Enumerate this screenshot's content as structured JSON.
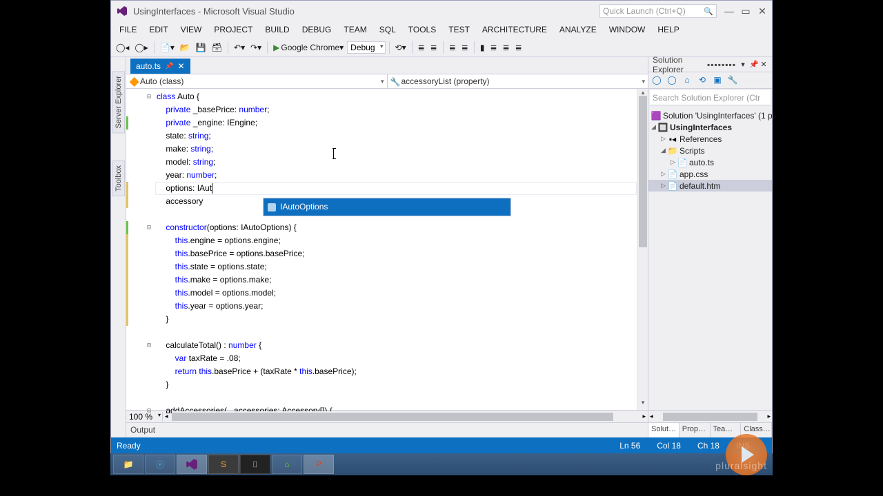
{
  "window": {
    "title": "UsingInterfaces - Microsoft Visual Studio",
    "quickLaunchPlaceholder": "Quick Launch (Ctrl+Q)"
  },
  "menu": [
    "FILE",
    "EDIT",
    "VIEW",
    "PROJECT",
    "BUILD",
    "DEBUG",
    "TEAM",
    "SQL",
    "TOOLS",
    "TEST",
    "ARCHITECTURE",
    "ANALYZE",
    "WINDOW",
    "HELP"
  ],
  "toolbar": {
    "browser": "Google Chrome",
    "config": "Debug"
  },
  "sideTabs": [
    "Server Explorer",
    "Toolbox"
  ],
  "fileTab": {
    "name": "auto.ts"
  },
  "navBar": {
    "left": "Auto (class)",
    "right": "accessoryList (property)"
  },
  "code": {
    "lines": [
      {
        "ind": 0,
        "fold": "⊟",
        "chg": "",
        "seg": [
          {
            "t": "class ",
            "c": "kw"
          },
          {
            "t": "Auto {",
            "c": "id"
          }
        ]
      },
      {
        "ind": 1,
        "chg": "",
        "seg": [
          {
            "t": "private ",
            "c": "kw"
          },
          {
            "t": "_basePrice: ",
            "c": "id"
          },
          {
            "t": "number",
            "c": "ty"
          },
          {
            "t": ";",
            "c": "id"
          }
        ]
      },
      {
        "ind": 1,
        "chg": "green",
        "seg": [
          {
            "t": "private ",
            "c": "kw"
          },
          {
            "t": "_engine: IEngine;",
            "c": "id"
          }
        ]
      },
      {
        "ind": 1,
        "chg": "",
        "seg": [
          {
            "t": "state: ",
            "c": "id"
          },
          {
            "t": "string",
            "c": "ty"
          },
          {
            "t": ";",
            "c": "id"
          }
        ]
      },
      {
        "ind": 1,
        "chg": "",
        "seg": [
          {
            "t": "make: ",
            "c": "id"
          },
          {
            "t": "string",
            "c": "ty"
          },
          {
            "t": ";",
            "c": "id"
          }
        ]
      },
      {
        "ind": 1,
        "chg": "",
        "seg": [
          {
            "t": "model: ",
            "c": "id"
          },
          {
            "t": "string",
            "c": "ty"
          },
          {
            "t": ";",
            "c": "id"
          }
        ]
      },
      {
        "ind": 1,
        "chg": "",
        "seg": [
          {
            "t": "year: ",
            "c": "id"
          },
          {
            "t": "number",
            "c": "ty"
          },
          {
            "t": ";",
            "c": "id"
          }
        ]
      },
      {
        "ind": 1,
        "chg": "yellow",
        "cur": true,
        "seg": [
          {
            "t": "options: IAut",
            "c": "id"
          }
        ]
      },
      {
        "ind": 1,
        "chg": "yellow",
        "seg": [
          {
            "t": "accessory",
            "c": "id"
          }
        ]
      },
      {
        "ind": 1,
        "chg": "",
        "seg": [
          {
            "t": "",
            "c": "id"
          }
        ]
      },
      {
        "ind": 1,
        "fold": "⊟",
        "chg": "green",
        "seg": [
          {
            "t": "constructor",
            "c": "kw"
          },
          {
            "t": "(options: IAutoOptions) {",
            "c": "id"
          }
        ]
      },
      {
        "ind": 2,
        "chg": "yellow",
        "seg": [
          {
            "t": "this",
            "c": "kw"
          },
          {
            "t": ".engine = options.engine;",
            "c": "id"
          }
        ]
      },
      {
        "ind": 2,
        "chg": "yellow",
        "seg": [
          {
            "t": "this",
            "c": "kw"
          },
          {
            "t": ".basePrice = options.basePrice;",
            "c": "id"
          }
        ]
      },
      {
        "ind": 2,
        "chg": "yellow",
        "seg": [
          {
            "t": "this",
            "c": "kw"
          },
          {
            "t": ".state = options.state;",
            "c": "id"
          }
        ]
      },
      {
        "ind": 2,
        "chg": "yellow",
        "seg": [
          {
            "t": "this",
            "c": "kw"
          },
          {
            "t": ".make = options.make;",
            "c": "id"
          }
        ]
      },
      {
        "ind": 2,
        "chg": "yellow",
        "seg": [
          {
            "t": "this",
            "c": "kw"
          },
          {
            "t": ".model = options.model;",
            "c": "id"
          }
        ]
      },
      {
        "ind": 2,
        "chg": "yellow",
        "seg": [
          {
            "t": "this",
            "c": "kw"
          },
          {
            "t": ".year = options.year;",
            "c": "id"
          }
        ]
      },
      {
        "ind": 1,
        "chg": "yellow",
        "seg": [
          {
            "t": "}",
            "c": "id"
          }
        ]
      },
      {
        "ind": 1,
        "chg": "",
        "seg": [
          {
            "t": "",
            "c": "id"
          }
        ]
      },
      {
        "ind": 1,
        "fold": "⊟",
        "chg": "",
        "seg": [
          {
            "t": "calculateTotal() : ",
            "c": "id"
          },
          {
            "t": "number",
            "c": "ty"
          },
          {
            "t": " {",
            "c": "id"
          }
        ]
      },
      {
        "ind": 2,
        "chg": "",
        "seg": [
          {
            "t": "var ",
            "c": "kw"
          },
          {
            "t": "taxRate = .08;",
            "c": "id"
          }
        ]
      },
      {
        "ind": 2,
        "chg": "",
        "seg": [
          {
            "t": "return ",
            "c": "kw"
          },
          {
            "t": "this",
            "c": "kw"
          },
          {
            "t": ".basePrice + (taxRate * ",
            "c": "id"
          },
          {
            "t": "this",
            "c": "kw"
          },
          {
            "t": ".basePrice);",
            "c": "id"
          }
        ]
      },
      {
        "ind": 1,
        "chg": "",
        "seg": [
          {
            "t": "}",
            "c": "id"
          }
        ]
      },
      {
        "ind": 1,
        "chg": "",
        "seg": [
          {
            "t": "",
            "c": "id"
          }
        ]
      },
      {
        "ind": 1,
        "fold": "⊟",
        "chg": "",
        "seg": [
          {
            "t": "addAccessories(...accessories: Accessory[]) {",
            "c": "id"
          }
        ]
      }
    ]
  },
  "intellisense": {
    "item": "IAutoOptions"
  },
  "zoom": "100 %",
  "outputPanelTitle": "Output",
  "solutionExplorer": {
    "title": "Solution Explorer",
    "searchPlaceholder": "Search Solution Explorer (Ctr",
    "items": [
      {
        "depth": 0,
        "arrow": "",
        "icon": "sln",
        "label": "Solution 'UsingInterfaces' (1 p",
        "bold": false
      },
      {
        "depth": 0,
        "arrow": "◢",
        "icon": "proj",
        "label": "UsingInterfaces",
        "bold": true
      },
      {
        "depth": 1,
        "arrow": "▷",
        "icon": "ref",
        "label": "References",
        "bold": false
      },
      {
        "depth": 1,
        "arrow": "◢",
        "icon": "fld",
        "label": "Scripts",
        "bold": false
      },
      {
        "depth": 2,
        "arrow": "▷",
        "icon": "ts",
        "label": "auto.ts",
        "bold": false
      },
      {
        "depth": 1,
        "arrow": "▷",
        "icon": "css",
        "label": "app.css",
        "bold": false
      },
      {
        "depth": 1,
        "arrow": "▷",
        "icon": "htm",
        "label": "default.htm",
        "bold": false,
        "sel": true
      }
    ],
    "tabs": [
      "Solut…",
      "Prop…",
      "Tea…",
      "Class…"
    ]
  },
  "status": {
    "ready": "Ready",
    "ln": "Ln 56",
    "col": "Col 18",
    "ch": "Ch 18",
    "ins": "INS"
  },
  "watermark": "pluralsight"
}
